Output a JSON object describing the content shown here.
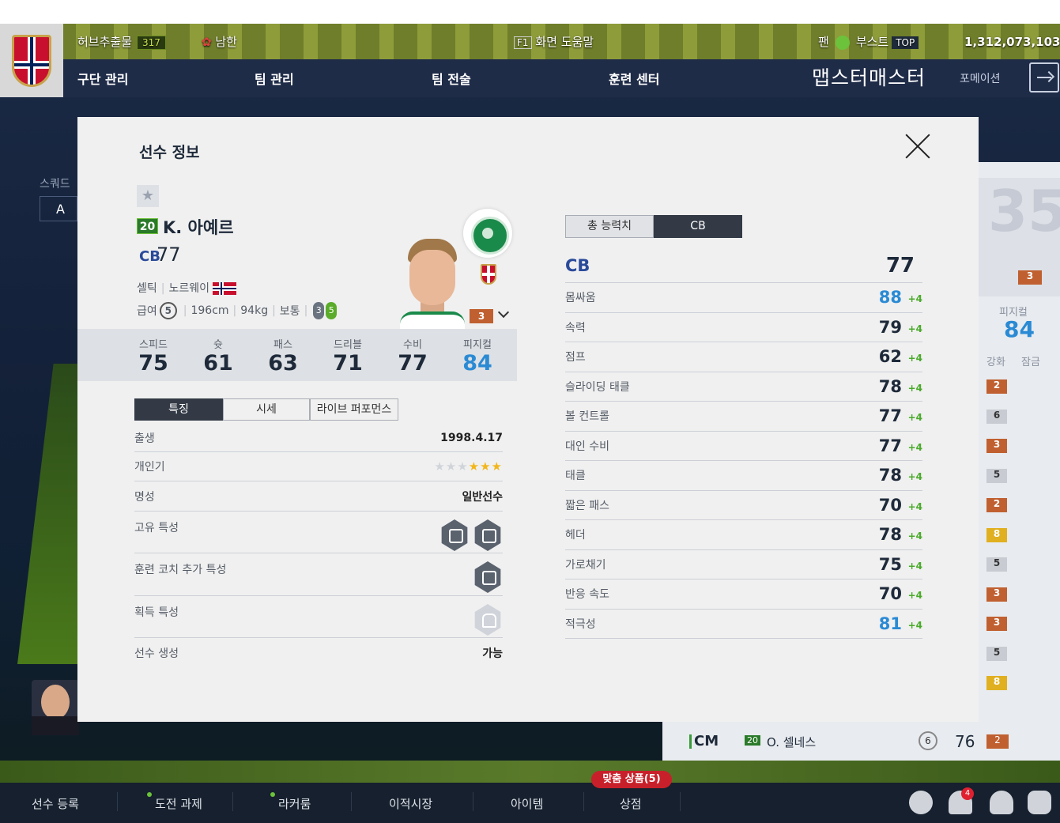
{
  "topbar": {
    "currency_label": "허브추출물",
    "currency_value": "317",
    "fan_label": "남한",
    "help_key": "F1",
    "help_label": "화면 도움말",
    "fan2_label": "팬",
    "boost_label": "부스트",
    "boost_badge": "TOP",
    "bp_value": "1,312,073,103"
  },
  "nav": {
    "items": [
      "구단 관리",
      "팀 관리",
      "팀 전술",
      "훈련 센터"
    ],
    "manager_name": "맵스터매스터",
    "formation_label": "포메이션"
  },
  "left_panel": {
    "squad_label": "스쿼드",
    "squad_value": "A"
  },
  "right_panel": {
    "number": "35",
    "physical_label": "피지컬",
    "physical_value": "84",
    "enhance_label": "강화",
    "lock_label": "잠금",
    "grade_top": "3",
    "grades": [
      "2",
      "6",
      "3",
      "5",
      "2",
      "8",
      "5",
      "3",
      "3",
      "5",
      "8"
    ]
  },
  "bottom_player": {
    "position": "CM",
    "season": "20",
    "name": "O. 셀네스",
    "ring": "6",
    "ovr": "76",
    "grade": "2"
  },
  "footer": {
    "items": [
      "선수 등록",
      "도전 과제",
      "라커룸",
      "이적시장",
      "아이템",
      "상점"
    ],
    "promo": "맞춤 상품(5)",
    "bell_count": "4"
  },
  "modal": {
    "title": "선수 정보",
    "player": {
      "season": "20",
      "name": "K. 아예르",
      "position": "CB",
      "ovr": "77",
      "club": "셀틱",
      "nation": "노르웨이",
      "salary_label": "급여",
      "salary": "5",
      "height": "196cm",
      "weight": "94kg",
      "body": "보통",
      "weak_foot": "3",
      "strong_foot": "5",
      "grade": "3"
    },
    "summary": [
      {
        "label": "스피드",
        "value": "75"
      },
      {
        "label": "슛",
        "value": "61"
      },
      {
        "label": "패스",
        "value": "63"
      },
      {
        "label": "드리블",
        "value": "71"
      },
      {
        "label": "수비",
        "value": "77"
      },
      {
        "label": "피지컬",
        "value": "84"
      }
    ],
    "tabs": [
      "특징",
      "시세",
      "라이브 퍼포먼스"
    ],
    "info": {
      "birth_label": "출생",
      "birth_value": "1998.4.17",
      "popularity_label": "개인기",
      "popularity_stars": 3,
      "reputation_label": "명성",
      "reputation_value": "일반선수",
      "unique_trait_label": "고유 특성",
      "coach_trait_label": "훈련 코치 추가 특성",
      "acquired_trait_label": "획득 특성",
      "create_label": "선수 생성",
      "create_value": "가능"
    },
    "stat_tabs": [
      "총 능력치",
      "CB"
    ],
    "stat_header": {
      "label": "CB",
      "value": "77"
    },
    "stats": [
      {
        "label": "몸싸움",
        "value": "88",
        "bonus": "+4"
      },
      {
        "label": "속력",
        "value": "79",
        "bonus": "+4"
      },
      {
        "label": "점프",
        "value": "62",
        "bonus": "+4"
      },
      {
        "label": "슬라이딩 태클",
        "value": "78",
        "bonus": "+4"
      },
      {
        "label": "볼 컨트롤",
        "value": "77",
        "bonus": "+4"
      },
      {
        "label": "대인 수비",
        "value": "77",
        "bonus": "+4"
      },
      {
        "label": "태클",
        "value": "78",
        "bonus": "+4"
      },
      {
        "label": "짧은 패스",
        "value": "70",
        "bonus": "+4"
      },
      {
        "label": "헤더",
        "value": "78",
        "bonus": "+4"
      },
      {
        "label": "가로채기",
        "value": "75",
        "bonus": "+4"
      },
      {
        "label": "반응 속도",
        "value": "70",
        "bonus": "+4"
      },
      {
        "label": "적극성",
        "value": "81",
        "bonus": "+4"
      }
    ]
  },
  "colors": {
    "accent_blue": "#2a8ad4",
    "bonus_green": "#4aaa2a",
    "grade_bronze": "#c06030",
    "nav_bg": "#1f2c48"
  }
}
